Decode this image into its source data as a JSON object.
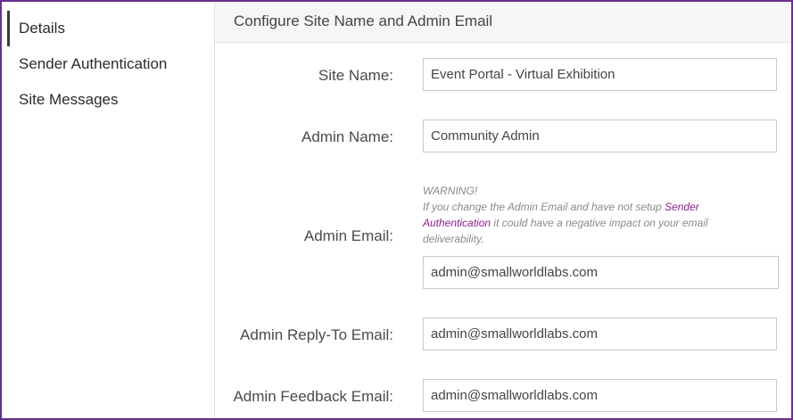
{
  "sidebar": {
    "items": [
      {
        "label": "Details",
        "active": true
      },
      {
        "label": "Sender Authentication",
        "active": false
      },
      {
        "label": "Site Messages",
        "active": false
      }
    ]
  },
  "header": {
    "title": "Configure Site Name and Admin Email"
  },
  "form": {
    "site_name": {
      "label": "Site Name:",
      "value": "Event Portal - Virtual Exhibition"
    },
    "admin_name": {
      "label": "Admin Name:",
      "value": "Community Admin"
    },
    "admin_email": {
      "label": "Admin Email:",
      "value": "admin@smallworldlabs.com",
      "warning_title": "WARNING!",
      "warning_pre": "If you change the Admin Email and have not setup ",
      "warning_link": "Sender Authentication",
      "warning_post": " it could have a negative impact on your email deliverability."
    },
    "admin_reply_to": {
      "label": "Admin Reply-To Email:",
      "value": "admin@smallworldlabs.com"
    },
    "admin_feedback": {
      "label": "Admin Feedback Email:",
      "value": "admin@smallworldlabs.com"
    }
  },
  "colors": {
    "frame_border": "#6b2d8c",
    "link": "#8c1f8c",
    "header_bg": "#f6f6f6"
  }
}
